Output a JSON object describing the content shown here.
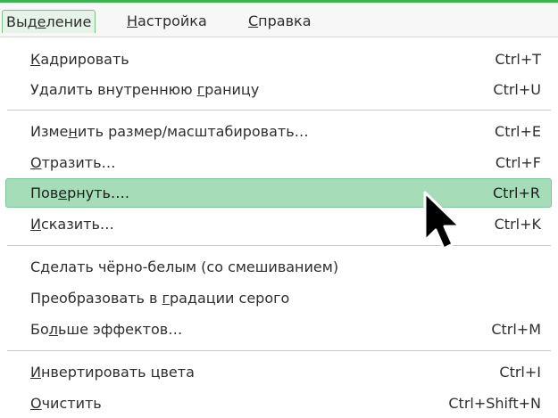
{
  "menubar": {
    "items": [
      {
        "pre": "Выд",
        "u": "е",
        "post": "ление"
      },
      {
        "pre": "",
        "u": "Н",
        "post": "астройка"
      },
      {
        "pre": "",
        "u": "С",
        "post": "правка"
      }
    ]
  },
  "menu": {
    "items": [
      {
        "pre": "",
        "u": "К",
        "post": "адрировать",
        "shortcut": "Ctrl+T"
      },
      {
        "pre": "Удалить внутреннюю ",
        "u": "г",
        "post": "раницу",
        "shortcut": "Ctrl+U"
      },
      {
        "pre": "Изме",
        "u": "н",
        "post": "ить размер/масштабировать…",
        "shortcut": "Ctrl+E"
      },
      {
        "pre": "",
        "u": "О",
        "post": "тразить…",
        "shortcut": "Ctrl+F"
      },
      {
        "pre": "Пов",
        "u": "е",
        "post": "рнуть….",
        "shortcut": "Ctrl+R"
      },
      {
        "pre": "",
        "u": "И",
        "post": "сказить…",
        "shortcut": "Ctrl+K"
      },
      {
        "pre": "Сделать чёрно-белым (со смешиванием)",
        "u": "",
        "post": "",
        "shortcut": ""
      },
      {
        "pre": "Преобразовать в ",
        "u": "г",
        "post": "радации серого",
        "shortcut": ""
      },
      {
        "pre": "Бо",
        "u": "л",
        "post": "ьше эффектов…",
        "shortcut": "Ctrl+M"
      },
      {
        "pre": "",
        "u": "И",
        "post": "нвертировать цвета",
        "shortcut": "Ctrl+I"
      },
      {
        "pre": "",
        "u": "О",
        "post": "чистить",
        "shortcut": "Ctrl+Shift+N"
      }
    ]
  },
  "colors": {
    "accent": "#3fb34f",
    "highlight": "#a6dcb8"
  }
}
